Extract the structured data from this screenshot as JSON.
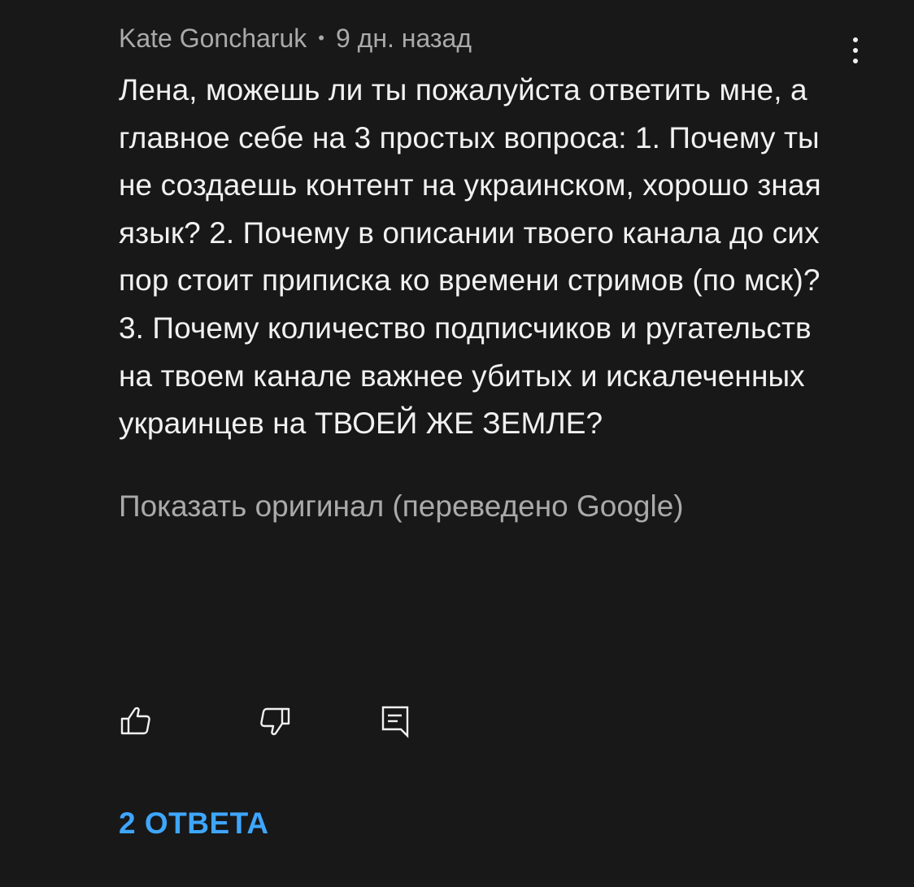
{
  "comment": {
    "author": "Kate Goncharuk",
    "separator": "•",
    "time": "9 дн. назад",
    "text": "Лена, можешь ли ты пожалуйста ответить мне, а главное себе на 3 простых вопроса: 1. Почему ты не создаешь контент на украинском, хорошо зная язык? 2. Почему в описании твоего канала до сих пор стоит приписка ко времени стримов (по мск)? 3. Почему количество подписчиков и ругательств на твоем канале важнее убитых и искалеченных украинцев на ТВОЕЙ ЖЕ ЗЕМЛЕ?",
    "translation_toggle": "Показать оригинал (переведено Google)",
    "replies_label": "2 ОТВЕТА"
  },
  "icons": {
    "more": "more-vertical-icon",
    "like": "thumbs-up-icon",
    "dislike": "thumbs-down-icon",
    "reply": "comment-reply-icon"
  },
  "colors": {
    "background": "#181818",
    "text": "#f1f1f1",
    "secondary": "#aaaaaa",
    "accent": "#3ea6ff"
  }
}
